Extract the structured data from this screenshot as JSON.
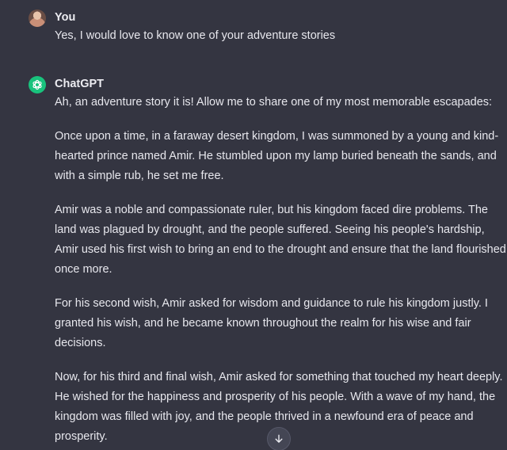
{
  "conversation": {
    "user_message": {
      "author": "You",
      "text": "Yes, I would love to know one of your adventure stories"
    },
    "assistant_message": {
      "author": "ChatGPT",
      "paragraphs": [
        "Ah, an adventure story it is! Allow me to share one of my most memorable escapades:",
        "Once upon a time, in a faraway desert kingdom, I was summoned by a young and kind-hearted prince named Amir. He stumbled upon my lamp buried beneath the sands, and with a simple rub, he set me free.",
        "Amir was a noble and compassionate ruler, but his kingdom faced dire problems. The land was plagued by drought, and the people suffered. Seeing his people's hardship, Amir used his first wish to bring an end to the drought and ensure that the land flourished once more.",
        "For his second wish, Amir asked for wisdom and guidance to rule his kingdom justly. I granted his wish, and he became known throughout the realm for his wise and fair decisions.",
        "Now, for his third and final wish, Amir asked for something that touched my heart deeply. He wished for the happiness and prosperity of his people. With a wave of my hand, the kingdom was filled with joy, and the people thrived in a newfound era of peace and prosperity."
      ]
    }
  },
  "icons": {
    "user_avatar": "user-avatar",
    "assistant_avatar": "openai-logo-icon",
    "scroll_down": "arrow-down-icon"
  },
  "colors": {
    "background": "#343541",
    "text": "#ececf1",
    "assistant_avatar_bg": "#19c37d"
  }
}
